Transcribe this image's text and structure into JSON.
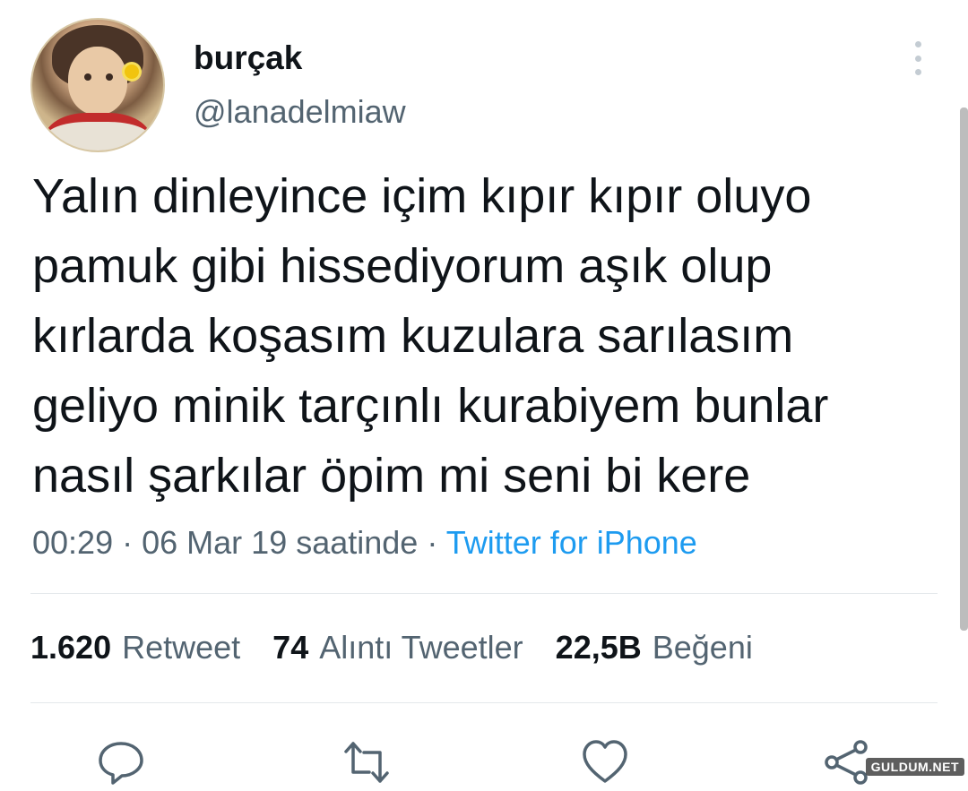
{
  "author": {
    "display_name": "burçak",
    "handle": "@lanadelmiaw"
  },
  "tweet": {
    "text": "Yalın dinleyince içim kıpır kıpır oluyo\npamuk gibi hissediyorum aşık olup\nkırlarda koşasım kuzulara sarılasım\ngeliyo minik tarçınlı kurabiyem bunlar\nnasıl şarkılar öpim mi seni bi kere",
    "time": "00:29",
    "date": "06 Mar 19 saatinde",
    "separator": "·",
    "source": "Twitter for iPhone"
  },
  "stats": {
    "retweets_count": "1.620",
    "retweets_label": "Retweet",
    "quotes_count": "74",
    "quotes_label": "Alıntı Tweetler",
    "likes_count": "22,5B",
    "likes_label": "Beğeni"
  },
  "actions": {
    "reply_icon": "reply-icon",
    "retweet_icon": "retweet-icon",
    "like_icon": "heart-icon",
    "share_icon": "share-icon"
  },
  "watermark": "GULDUM.NET",
  "colors": {
    "text": "#0f1419",
    "muted": "#536471",
    "link": "#1d9bf0"
  }
}
